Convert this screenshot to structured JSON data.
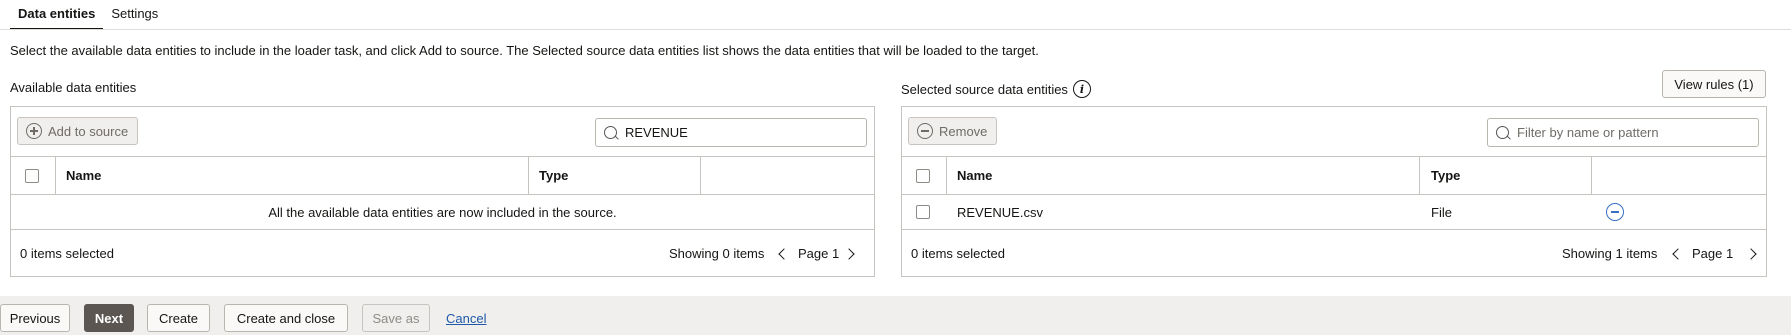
{
  "tabs": [
    {
      "label": "Data entities",
      "active": true
    },
    {
      "label": "Settings",
      "active": false
    }
  ],
  "description": "Select the available data entities to include in the loader task, and click Add to source. The Selected source data entities list shows the data entities that will be loaded to the target.",
  "available": {
    "title": "Available data entities",
    "add_button": "Add to source",
    "search_value": "REVENUE",
    "columns": [
      "Name",
      "Type"
    ],
    "empty_message": "All the available data entities are now included in the source.",
    "selected_count": "0 items selected",
    "showing": "Showing 0 items",
    "page": "Page 1"
  },
  "selected": {
    "title": "Selected source data entities",
    "view_rules": "View rules (1)",
    "remove_button": "Remove",
    "filter_placeholder": "Filter by name or pattern",
    "columns": [
      "Name",
      "Type"
    ],
    "rows": [
      {
        "name": "REVENUE.csv",
        "type": "File"
      }
    ],
    "selected_count": "0 items selected",
    "showing": "Showing 1 items",
    "page": "Page 1"
  },
  "footer": {
    "previous": "Previous",
    "next": "Next",
    "create": "Create",
    "create_and_close": "Create and close",
    "save_as": "Save as",
    "cancel": "Cancel"
  },
  "colors": {
    "primary_button": "#5b5652",
    "link": "#1e5aa8",
    "remove_icon": "#3a6fc4"
  }
}
